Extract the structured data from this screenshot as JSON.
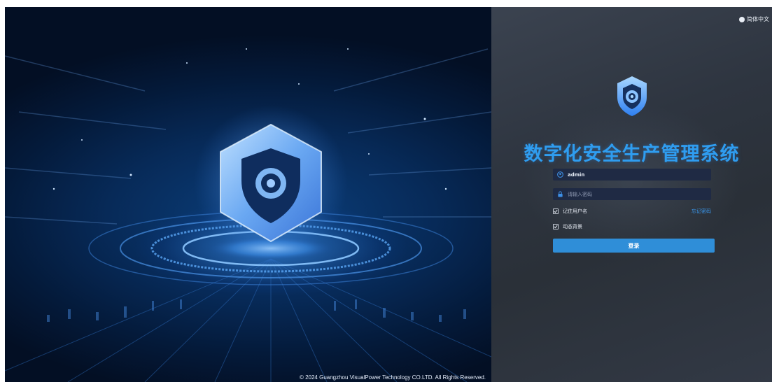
{
  "app": {
    "title": "数字化安全生产管理系统",
    "language_label": "简体中文",
    "copyright": "© 2024 Guangzhou VisualPower Technology CO.LTD. All Rights Reserved."
  },
  "login": {
    "username_value": "admin",
    "password_placeholder": "请输入密码",
    "remember_label": "记住用户名",
    "remember_checked": true,
    "dynamic_bg_label": "动态背景",
    "dynamic_bg_checked": true,
    "forgot_label": "忘记密码",
    "submit_label": "登录"
  },
  "colors": {
    "accent": "#2f9df0",
    "button": "#2f8ed8",
    "panel": "#2e3540",
    "hero": "#072a58"
  },
  "icons": {
    "language": "globe-icon",
    "user": "user-icon",
    "password": "lock-icon",
    "logo": "shield-eye-icon"
  }
}
